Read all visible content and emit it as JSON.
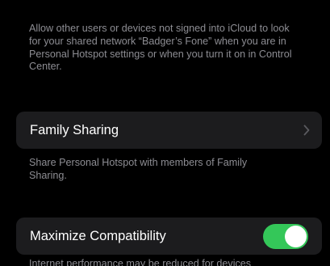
{
  "hotspot_visibility": {
    "footnote": "Allow other users or devices not signed into iCloud to look for your shared network “Badger’s Fone” when you are in Personal Hotspot settings or when you turn it on in Control Center."
  },
  "family_sharing": {
    "label": "Family Sharing",
    "chevron_icon": "chevron-right-icon",
    "footnote": "Share Personal Hotspot with members of Family Sharing."
  },
  "maximize_compatibility": {
    "label": "Maximize Compatibility",
    "toggle_on": true,
    "toggle_color": "#34c759",
    "footnote": "Internet performance may be reduced for devices"
  },
  "colors": {
    "background": "#000000",
    "cell_background": "#1c1c1e",
    "footnote_text": "#8d8d93",
    "label_text": "#ffffff"
  }
}
